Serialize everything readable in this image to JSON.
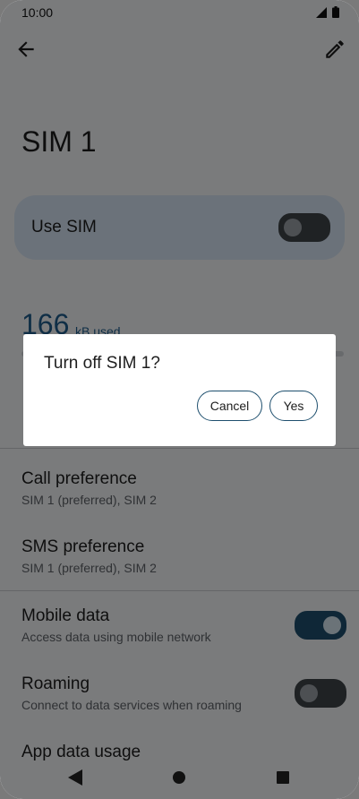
{
  "status_bar": {
    "time": "10:00"
  },
  "header": {
    "title": "SIM 1"
  },
  "use_sim": {
    "label": "Use SIM",
    "enabled": false
  },
  "usage": {
    "amount": "166",
    "unit": "kB used"
  },
  "rows": [
    {
      "title": "Call preference",
      "subtitle": "SIM 1 (preferred), SIM 2"
    },
    {
      "title": "SMS preference",
      "subtitle": "SIM 1 (preferred), SIM 2"
    },
    {
      "title": "Mobile data",
      "subtitle": "Access data using mobile network",
      "enabled": true
    },
    {
      "title": "Roaming",
      "subtitle": "Connect to data services when roaming",
      "enabled": false
    },
    {
      "title": "App data usage",
      "subtitle": ""
    }
  ],
  "dialog": {
    "title": "Turn off SIM 1?",
    "cancel_label": "Cancel",
    "yes_label": "Yes"
  },
  "colors": {
    "accent": "#1e4f6e",
    "card": "#d6e4f4",
    "scrim": "#000000"
  }
}
